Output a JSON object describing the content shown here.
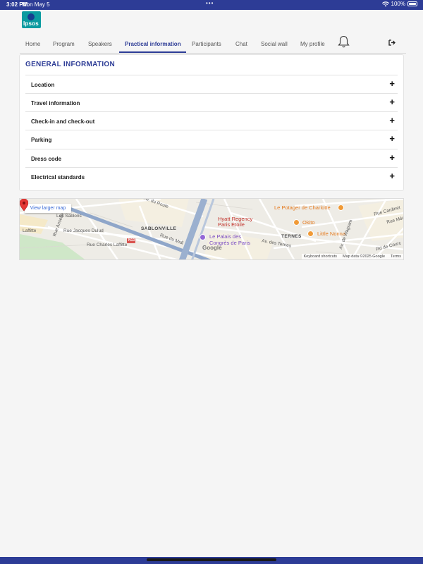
{
  "status_bar": {
    "time": "3:02 PM",
    "date": "Mon May 5",
    "battery": "100%",
    "dots": "•••"
  },
  "logo": {
    "text": "Ipsos"
  },
  "nav": {
    "items": [
      "Home",
      "Program",
      "Speakers",
      "Practical information",
      "Participants",
      "Chat",
      "Social wall",
      "My profile"
    ],
    "active": "Practical information"
  },
  "section": {
    "title": "GENERAL INFORMATION",
    "items": [
      {
        "label": "Location"
      },
      {
        "label": "Travel information"
      },
      {
        "label": "Check-in and check-out"
      },
      {
        "label": "Parking"
      },
      {
        "label": "Dress code"
      },
      {
        "label": "Electrical standards"
      }
    ],
    "expand_symbol": "+"
  },
  "map": {
    "view_larger": "View larger map",
    "labels": {
      "sablons": "Les Sablons",
      "jacques_dulud": "Rue Jacques Dulud",
      "charles_laffitte": "Rue Charles Laffitte",
      "anselle": "Rue Anselle",
      "laffitte": "Laffitte",
      "av_roule": "Av. du Roule",
      "sablonville": "SABLONVILLE",
      "midi": "Rue du Midi",
      "n13": "N13",
      "hotel_1": "Hyatt Regency",
      "hotel_2": "Paris Etoile",
      "palais_1": "Le Palais des",
      "palais_2": "Congrès de Paris",
      "ternes_av": "Av. des Ternes",
      "ternes": "TERNES",
      "potager": "Le Potager de Charlotte",
      "okito": "Okito",
      "nonna": "Little Nonna",
      "cardinet": "Rue Cardinet",
      "medan": "Rue Médan",
      "wagram": "Av. de Wagram",
      "courcelles": "Rd de Courc",
      "google": "Google"
    },
    "attribution": {
      "shortcuts": "Keyboard shortcuts",
      "data": "Map data ©2025 Google",
      "terms": "Terms"
    },
    "colors": {
      "road": "#ffffff",
      "highway": "#8fa6c9",
      "park": "#cfe7c8",
      "block": "#f3f1ec"
    }
  },
  "colors": {
    "brand": "#2d3c96",
    "accent_teal": "#0b9ba0"
  }
}
